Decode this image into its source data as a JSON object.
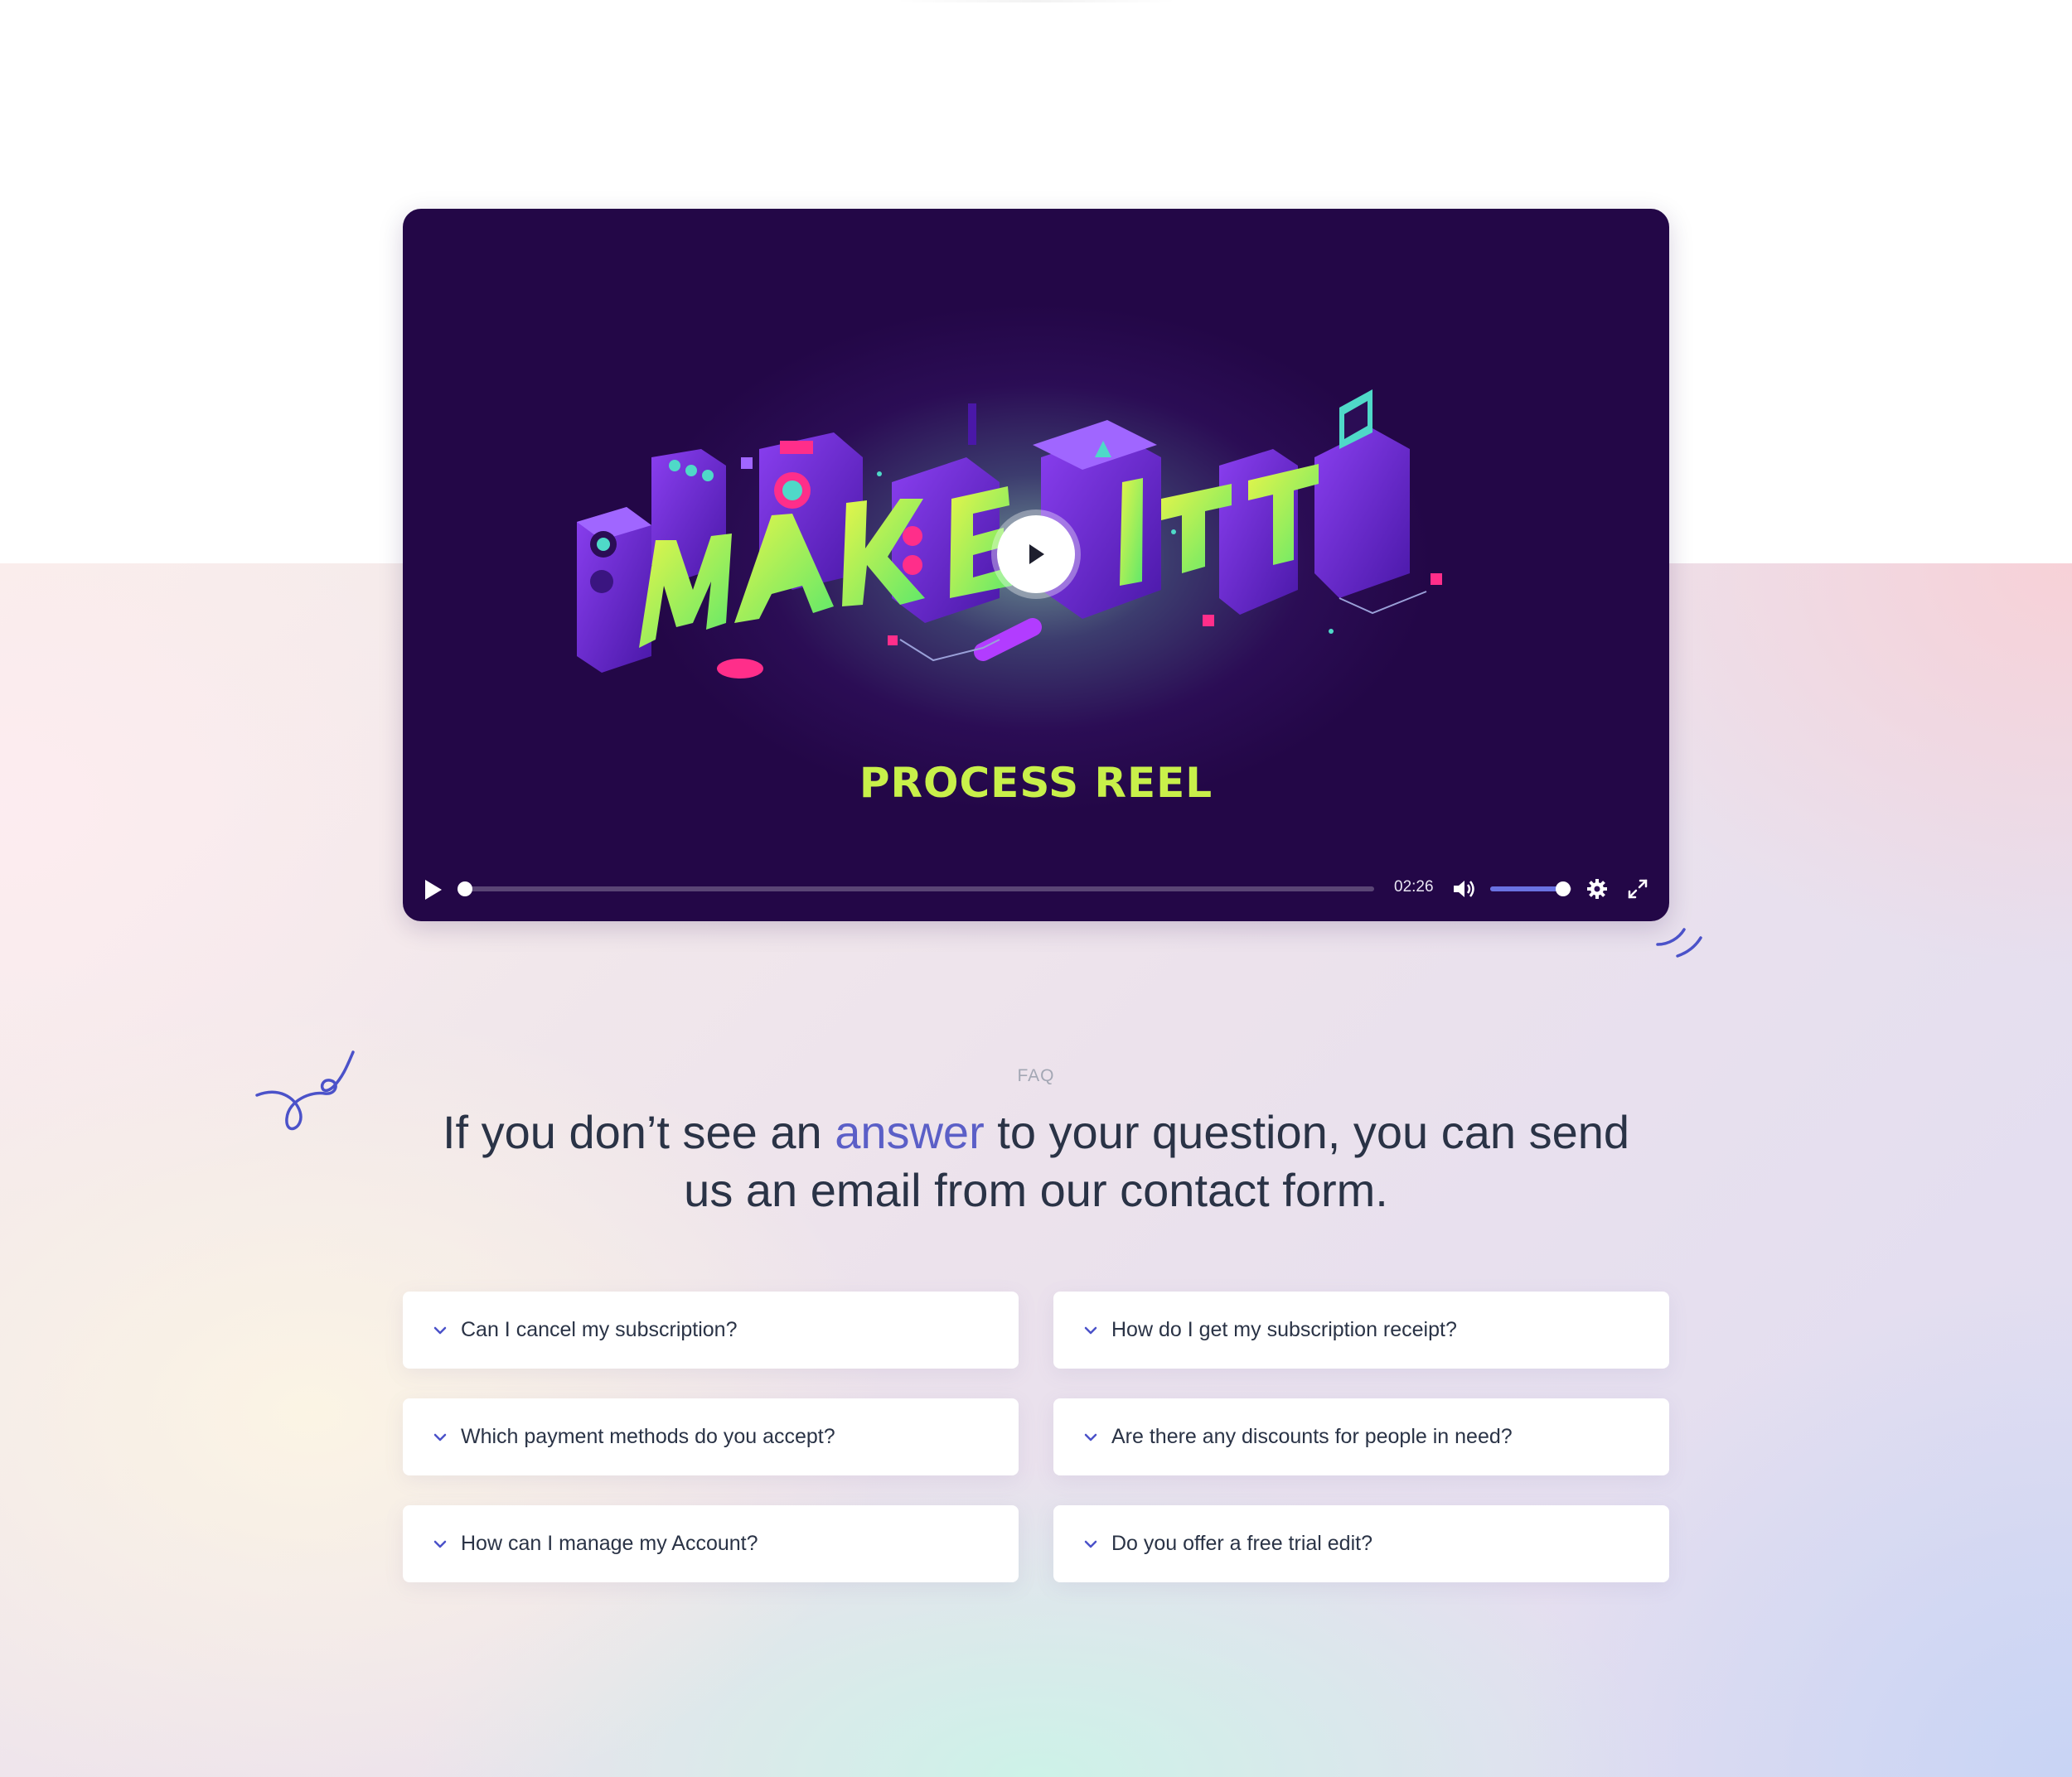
{
  "video": {
    "subtitle": "PROCESS REEL",
    "time": "02:26",
    "progress": 0.0,
    "volume": 0.9,
    "colors": {
      "background": "#230747",
      "accent_green": "#c8f04a",
      "accent_blue": "#6a72e2"
    },
    "icons": [
      "play-icon",
      "volume-icon",
      "settings-icon",
      "fullscreen-icon"
    ]
  },
  "faq": {
    "eyebrow": "FAQ",
    "headline_before": "If you don’t see an ",
    "headline_accent": "answer",
    "headline_after": " to your question, you can send us an email from our contact form.",
    "accent_color": "#5b5fc7",
    "items": [
      {
        "question": "Can I cancel my subscription?"
      },
      {
        "question": "How do I get my subscription receipt?"
      },
      {
        "question": "Which payment methods do you accept?"
      },
      {
        "question": "Are there any discounts for people in need?"
      },
      {
        "question": "How can I manage my Account?"
      },
      {
        "question": "Do you offer a free trial edit?"
      }
    ]
  }
}
